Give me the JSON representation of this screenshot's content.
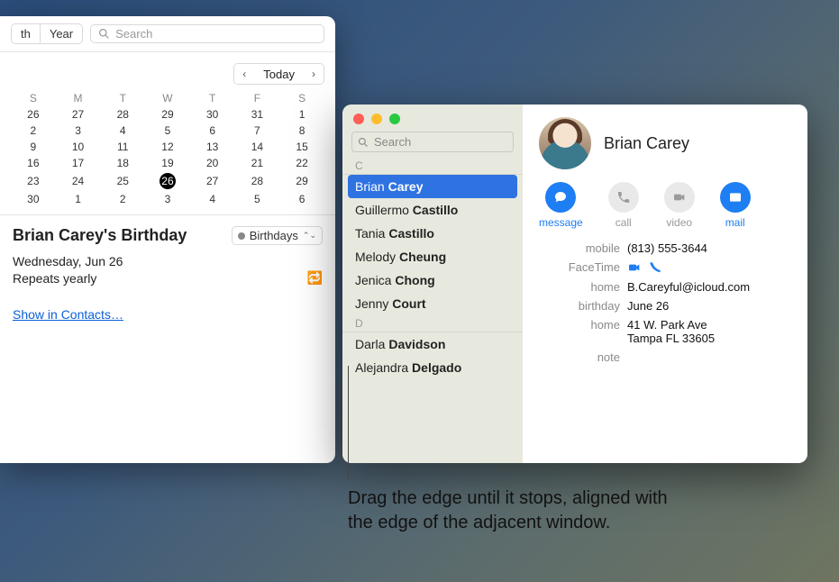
{
  "calendar": {
    "view_seg": [
      "th",
      "Year"
    ],
    "search_placeholder": "Search",
    "today_label": "Today",
    "dow": [
      "S",
      "M",
      "T",
      "W",
      "T",
      "F",
      "S"
    ],
    "weeks": [
      [
        {
          "d": "26",
          "dim": true
        },
        {
          "d": "27",
          "dim": true
        },
        {
          "d": "28",
          "dim": true
        },
        {
          "d": "29",
          "dim": true
        },
        {
          "d": "30",
          "dim": true
        },
        {
          "d": "31",
          "dim": true
        },
        {
          "d": "1"
        }
      ],
      [
        {
          "d": "2"
        },
        {
          "d": "3"
        },
        {
          "d": "4"
        },
        {
          "d": "5"
        },
        {
          "d": "6"
        },
        {
          "d": "7"
        },
        {
          "d": "8"
        }
      ],
      [
        {
          "d": "9"
        },
        {
          "d": "10",
          "red": true
        },
        {
          "d": "11"
        },
        {
          "d": "12"
        },
        {
          "d": "13"
        },
        {
          "d": "14"
        },
        {
          "d": "15"
        }
      ],
      [
        {
          "d": "16"
        },
        {
          "d": "17"
        },
        {
          "d": "18"
        },
        {
          "d": "19"
        },
        {
          "d": "20"
        },
        {
          "d": "21"
        },
        {
          "d": "22"
        }
      ],
      [
        {
          "d": "23"
        },
        {
          "d": "24"
        },
        {
          "d": "25"
        },
        {
          "d": "26",
          "sel": true
        },
        {
          "d": "27"
        },
        {
          "d": "28"
        },
        {
          "d": "29"
        }
      ],
      [
        {
          "d": "30"
        },
        {
          "d": "1",
          "dim": true
        },
        {
          "d": "2",
          "dim": true
        },
        {
          "d": "3",
          "dim": true
        },
        {
          "d": "4",
          "dim": true
        },
        {
          "d": "5",
          "dim": true
        },
        {
          "d": "6",
          "dim": true
        }
      ]
    ],
    "event": {
      "title": "Brian Carey's Birthday",
      "calendar_name": "Birthdays",
      "date_line": "Wednesday, Jun 26",
      "repeat_line": "Repeats yearly",
      "link_text": "Show in Contacts…"
    }
  },
  "contacts": {
    "search_placeholder": "Search",
    "sections": [
      {
        "letter": "C",
        "rows": [
          {
            "first": "Brian",
            "last": "Carey",
            "selected": true
          },
          {
            "first": "Guillermo",
            "last": "Castillo"
          },
          {
            "first": "Tania",
            "last": "Castillo"
          },
          {
            "first": "Melody",
            "last": "Cheung"
          },
          {
            "first": "Jenica",
            "last": "Chong"
          },
          {
            "first": "Jenny",
            "last": "Court"
          }
        ]
      },
      {
        "letter": "D",
        "rows": [
          {
            "first": "Darla",
            "last": "Davidson"
          },
          {
            "first": "Alejandra",
            "last": "Delgado"
          }
        ]
      }
    ],
    "card": {
      "name": "Brian Carey",
      "actions": [
        {
          "key": "message",
          "label": "message",
          "active": true
        },
        {
          "key": "call",
          "label": "call",
          "active": false
        },
        {
          "key": "video",
          "label": "video",
          "active": false
        },
        {
          "key": "mail",
          "label": "mail",
          "active": true
        }
      ],
      "fields": {
        "mobile_label": "mobile",
        "mobile": "(813) 555-3644",
        "facetime_label": "FaceTime",
        "home_email_label": "home",
        "home_email": "B.Careyful@icloud.com",
        "birthday_label": "birthday",
        "birthday": "June 26",
        "home_addr_label": "home",
        "home_addr_1": "41 W. Park Ave",
        "home_addr_2": "Tampa FL 33605",
        "note_label": "note"
      }
    }
  },
  "callout": "Drag the edge until it stops, aligned with the edge of the adjacent window."
}
